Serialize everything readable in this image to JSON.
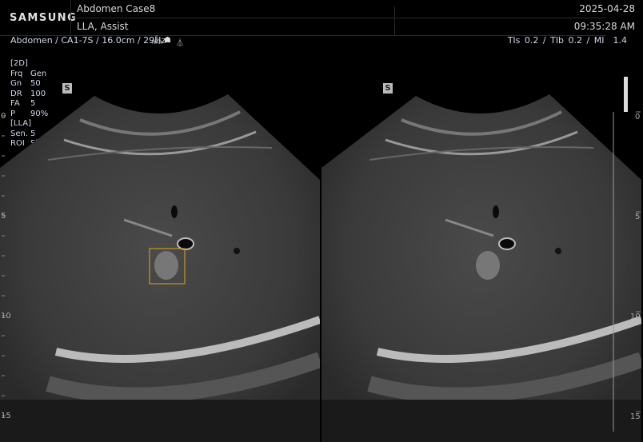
{
  "header": {
    "brand": "SAMSUNG",
    "patient": "Abdomen Case8",
    "mode_label": "LLA, Assist",
    "date": "2025-04-28",
    "time": "09:35:28 AM",
    "scan_info": "Abdomen / CA1-7S / 16.0cm / 29Hz",
    "har_label": "S HAR",
    "thermal": {
      "tis_label": "TIs",
      "tis": "0.2",
      "tib_label": "TIb",
      "tib": "0.2",
      "mi_label": "MI",
      "mi": "1.4"
    }
  },
  "params": [
    {
      "k": "[2D]",
      "v": ""
    },
    {
      "k": "Frq",
      "v": "Gen"
    },
    {
      "k": "Gn",
      "v": "50"
    },
    {
      "k": "DR",
      "v": "100"
    },
    {
      "k": "FA",
      "v": "5"
    },
    {
      "k": "P",
      "v": "90%"
    },
    {
      "k": "[LLA]",
      "v": ""
    },
    {
      "k": "Sen.",
      "v": "5"
    },
    {
      "k": "ROI",
      "v": "Show"
    }
  ],
  "image_badge": "S",
  "depth_ticks": [
    "0",
    "5",
    "10",
    "15"
  ],
  "colors": {
    "roi": "#c8961e",
    "text": "#d8d8d8"
  }
}
